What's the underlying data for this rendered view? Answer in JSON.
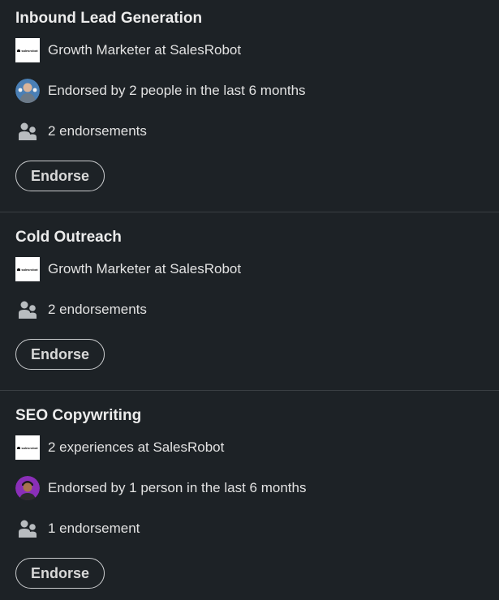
{
  "skills": [
    {
      "title": "Inbound Lead Generation",
      "rows": [
        {
          "icon": "company-logo",
          "text": "Growth Marketer at SalesRobot"
        },
        {
          "icon": "endorser-avatar",
          "text": "Endorsed by 2 people in the last 6 months"
        },
        {
          "icon": "people-icon",
          "text": "2 endorsements"
        }
      ],
      "button": "Endorse"
    },
    {
      "title": "Cold Outreach",
      "rows": [
        {
          "icon": "company-logo",
          "text": "Growth Marketer at SalesRobot"
        },
        {
          "icon": "people-icon",
          "text": "2 endorsements"
        }
      ],
      "button": "Endorse"
    },
    {
      "title": "SEO Copywriting",
      "rows": [
        {
          "icon": "company-logo",
          "text": "2 experiences at SalesRobot"
        },
        {
          "icon": "endorser-avatar",
          "text": "Endorsed by 1 person in the last 6 months"
        },
        {
          "icon": "people-icon",
          "text": "1 endorsement"
        }
      ],
      "button": "Endorse"
    }
  ],
  "company_logo_text": "salesrobot",
  "colors": {
    "background": "#1d2226",
    "divider": "#3a3f43",
    "text": "#e2e2e2",
    "button_border": "#c9cbcd"
  }
}
